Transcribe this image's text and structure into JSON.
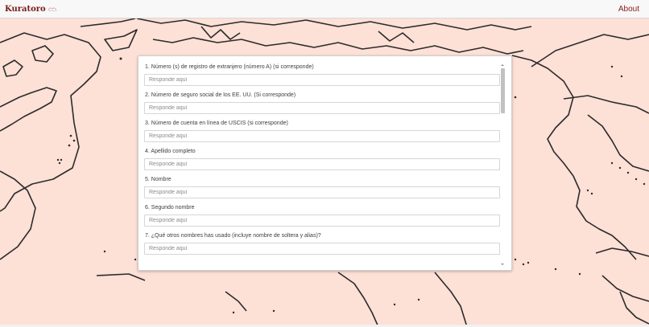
{
  "navbar": {
    "brand": "Kuratoro",
    "about": "About"
  },
  "form": {
    "questions": [
      {
        "label": "1. Número (s) de registro de extranjero (número A) (si corresponde)",
        "placeholder": "Responde aquí"
      },
      {
        "label": "2. Número de seguro social de los EE. UU. (Si corresponde)",
        "placeholder": "Responde aquí"
      },
      {
        "label": "3. Número de cuenta en línea de USCIS (si corresponde)",
        "placeholder": "Responde aquí"
      },
      {
        "label": "4. Apellido completo",
        "placeholder": "Responde aquí"
      },
      {
        "label": "5. Nombre",
        "placeholder": "Responde aquí"
      },
      {
        "label": "6. Segundo nombre",
        "placeholder": "Responde aquí"
      },
      {
        "label": "7. ¿Qué otros nombres has usado (incluye nombre de soltera y alias)?",
        "placeholder": "Responde aquí"
      }
    ]
  },
  "colors": {
    "background": "#fde0d6",
    "brand": "#7a1a1a",
    "map_outline": "#2b2b2b"
  },
  "icons": [
    "brand-logo-icon",
    "scroll-up-arrow-icon",
    "scroll-down-arrow-icon"
  ]
}
